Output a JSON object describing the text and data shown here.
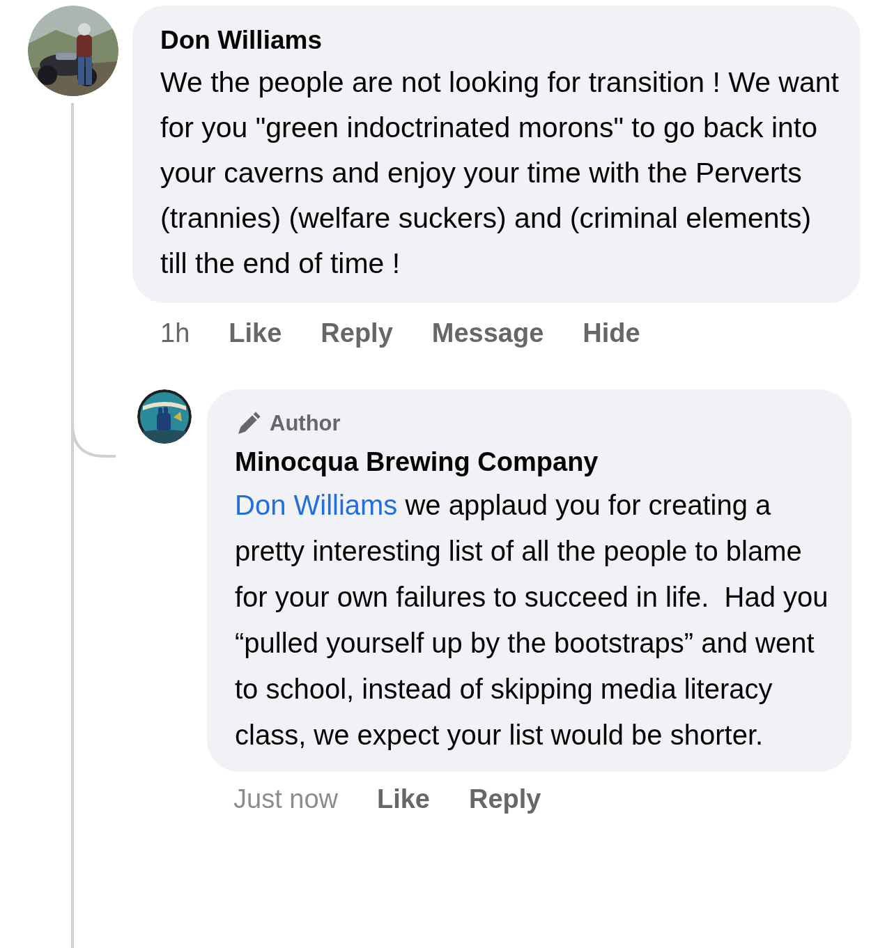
{
  "comment": {
    "author": "Don Williams",
    "text": "We the people are not looking for transition ! We want for you \"green indoctrinated morons\" to go back into your caverns and enjoy your time with the Perverts (trannies) (welfare suckers) and (criminal elements) till the end of time !",
    "time": "1h",
    "actions": [
      "Like",
      "Reply",
      "Message",
      "Hide"
    ]
  },
  "reply": {
    "badge": "Author",
    "author": "Minocqua Brewing Company",
    "mention": "Don Williams",
    "text": " we applaud you for creating a pretty interesting list of all the people to blame for your own failures to succeed in life.  Had you “pulled yourself up by the bootstraps” and went to school, instead of skipping media literacy class, we expect your list would be shorter.",
    "time": "Just now",
    "actions": [
      "Like",
      "Reply"
    ]
  }
}
